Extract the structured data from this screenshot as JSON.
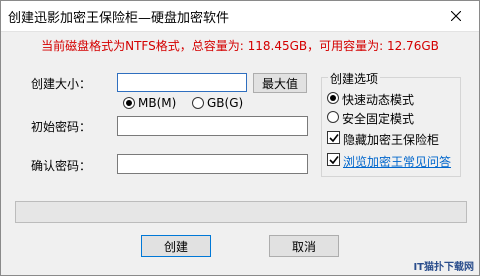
{
  "window": {
    "title": "创建迅影加密王保险柜—硬盘加密软件"
  },
  "notice": "当前磁盘格式为NTFS格式，总容量为: 118.45GB，可用容量为: 12.76GB",
  "form": {
    "size_label": "创建大小：",
    "size_value": "",
    "max_button": "最大值",
    "unit_mb": "MB(M)",
    "unit_gb": "GB(G)",
    "unit_selected": "MB(M)",
    "password_label": "初始密码：",
    "password_value": "",
    "confirm_label": "确认密码：",
    "confirm_value": ""
  },
  "options": {
    "legend": "创建选项",
    "fast_mode": "快速动态模式",
    "safe_mode": "安全固定模式",
    "selected_mode": "快速动态模式",
    "hide_label": "隐藏加密王保险柜",
    "hide_checked": true,
    "faq_label": "浏览加密王常见问答",
    "faq_checked": true
  },
  "progress": {
    "value": 0
  },
  "buttons": {
    "create": "创建",
    "cancel": "取消"
  },
  "watermark": "IT猫扑下载网",
  "colors": {
    "notice": "#d40000",
    "link": "#0066cc",
    "accent": "#0078d7"
  }
}
